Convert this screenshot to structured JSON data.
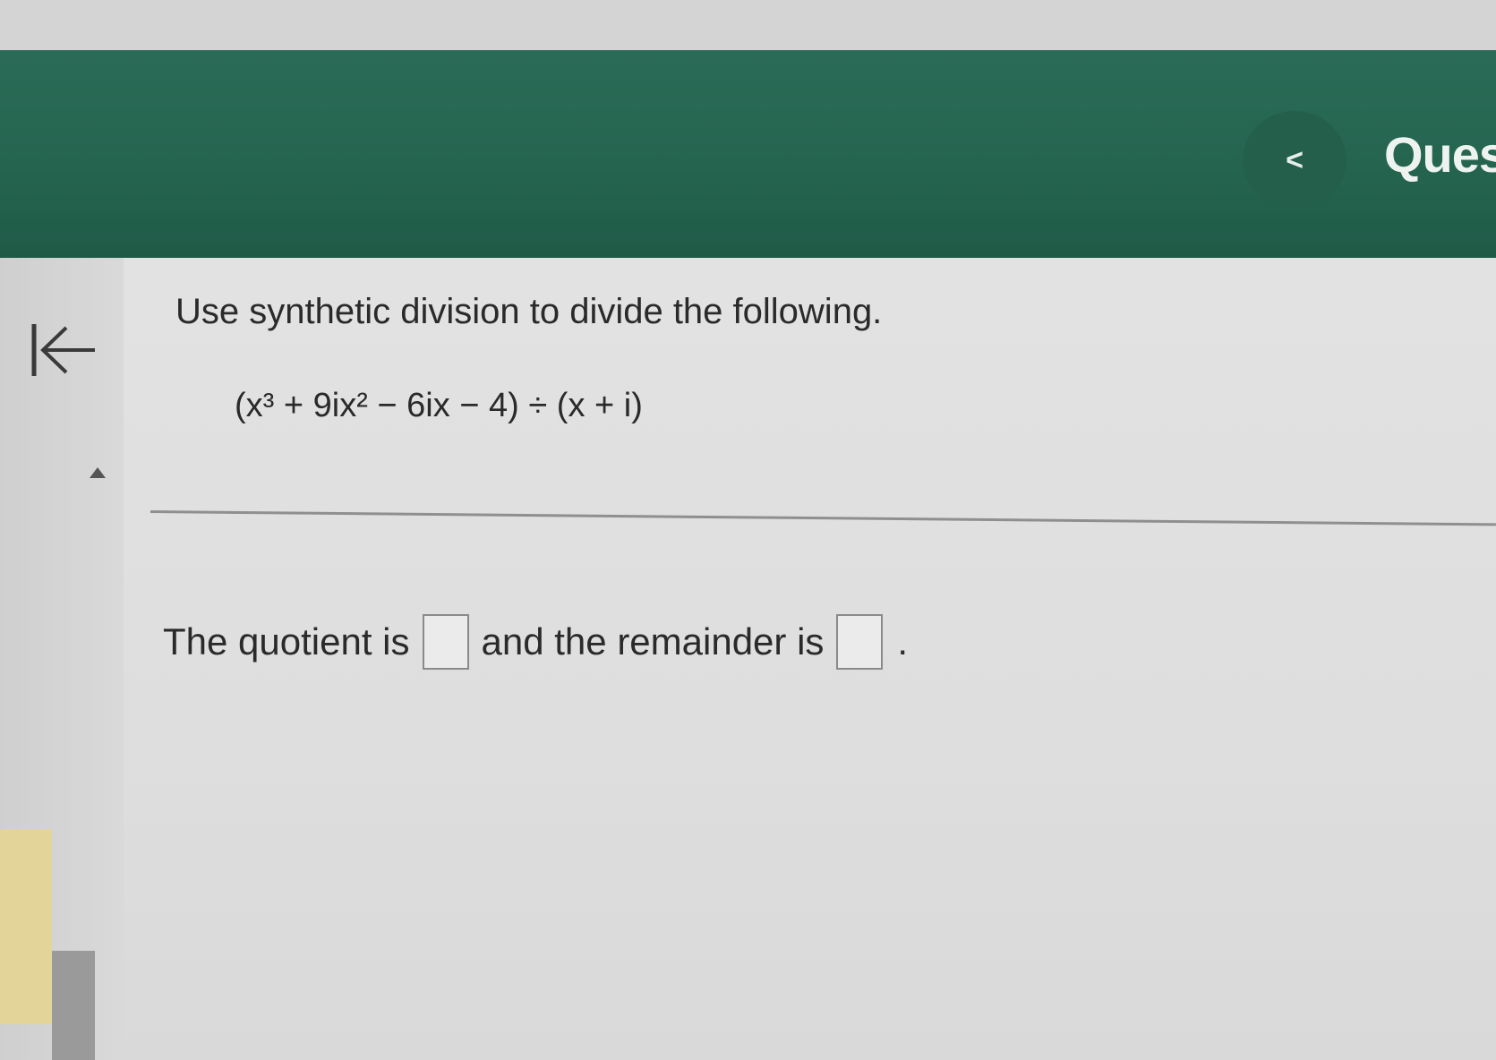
{
  "header": {
    "prev_label": "<",
    "title": "Ques",
    "bar_color": "#256550"
  },
  "sidebar": {
    "collapse_icon": "collapse-left-arrow-icon",
    "scroll_icon": "triangle-up-icon"
  },
  "question": {
    "instruction": "Use synthetic division to divide the following.",
    "expression": "(x³ + 9ix² − 6ix − 4) ÷ (x + i)",
    "answer_prefix": "The quotient is",
    "answer_middle": "and the remainder is",
    "answer_suffix": ".",
    "quotient_value": "",
    "remainder_value": ""
  }
}
